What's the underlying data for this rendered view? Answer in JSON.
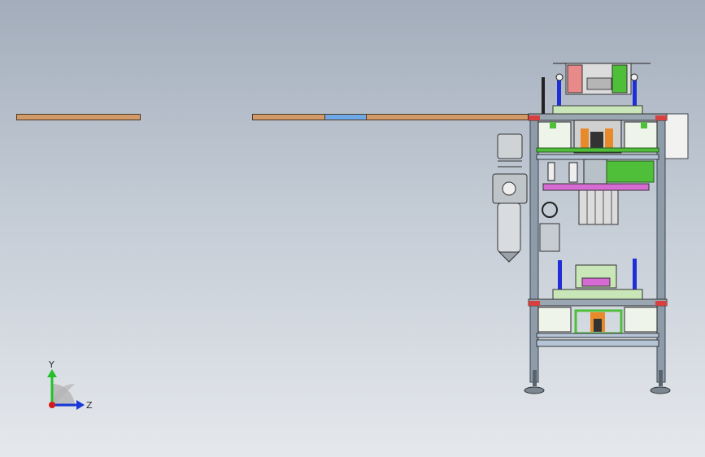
{
  "view": {
    "type": "cad-3d-viewport",
    "background_top": "#a3adbb",
    "background_bottom": "#e5e8ec"
  },
  "triad": {
    "y_label": "Y",
    "z_label": "Z",
    "y_color": "#22c02a",
    "z_color": "#1838d8",
    "origin_color": "#d81818"
  },
  "colors": {
    "beam_wood": "#d29a68",
    "beam_blue": "#6ea8e6",
    "frame": "#8e9ba8",
    "green_part": "#4fbf3a",
    "magenta_part": "#d66bd4",
    "blue_part": "#1e2fd8",
    "red_part": "#d84040",
    "orange_part": "#e88a2a",
    "filter_gray": "#cfd3d6"
  }
}
